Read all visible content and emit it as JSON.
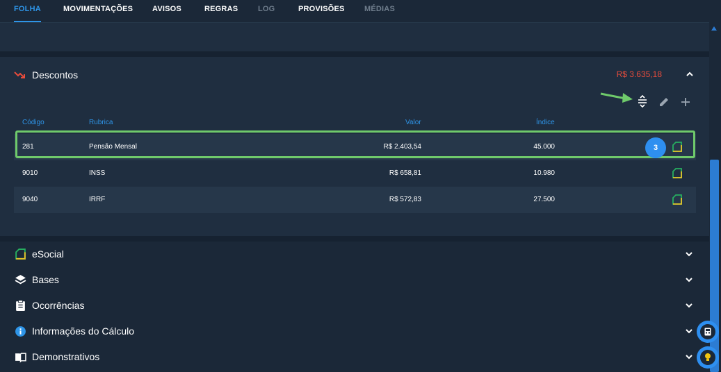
{
  "tabs": [
    {
      "label": "FOLHA",
      "state": "active"
    },
    {
      "label": "MOVIMENTAÇÕES",
      "state": "normal"
    },
    {
      "label": "AVISOS",
      "state": "normal"
    },
    {
      "label": "REGRAS",
      "state": "normal"
    },
    {
      "label": "LOG",
      "state": "disabled"
    },
    {
      "label": "PROVISÕES",
      "state": "normal"
    },
    {
      "label": "MÉDIAS",
      "state": "disabled"
    }
  ],
  "descontos": {
    "title": "Descontos",
    "total": "R$ 3.635,18",
    "columns": {
      "codigo": "Código",
      "rubrica": "Rubrica",
      "valor": "Valor",
      "indice": "Índice"
    },
    "rows": [
      {
        "codigo": "281",
        "rubrica": "Pensão Mensal",
        "valor": "R$ 2.403,54",
        "indice": "45.000"
      },
      {
        "codigo": "9010",
        "rubrica": "INSS",
        "valor": "R$ 658,81",
        "indice": "10.980"
      },
      {
        "codigo": "9040",
        "rubrica": "IRRF",
        "valor": "R$ 572,83",
        "indice": "27.500"
      }
    ],
    "step_badge": "3"
  },
  "sections": [
    {
      "label": "eSocial",
      "icon": "document-icon"
    },
    {
      "label": "Bases",
      "icon": "layers-icon"
    },
    {
      "label": "Ocorrências",
      "icon": "clipboard-icon"
    },
    {
      "label": "Informações do Cálculo",
      "icon": "info-icon"
    },
    {
      "label": "Demonstrativos",
      "icon": "book-icon"
    }
  ],
  "colors": {
    "accent": "#2e95e8",
    "negative": "#e74c3c",
    "highlight": "#6fca6b"
  }
}
